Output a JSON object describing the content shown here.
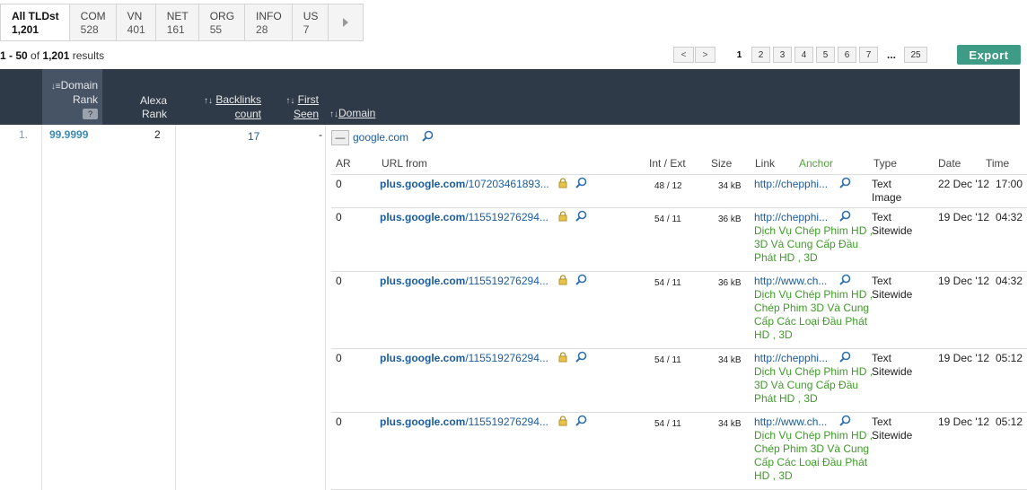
{
  "tld_tabs": [
    {
      "label": "All TLDst",
      "count": "1,201",
      "active": true
    },
    {
      "label": "COM",
      "count": "528"
    },
    {
      "label": "VN",
      "count": "401"
    },
    {
      "label": "NET",
      "count": "161"
    },
    {
      "label": "ORG",
      "count": "55"
    },
    {
      "label": "INFO",
      "count": "28"
    },
    {
      "label": "US",
      "count": "7"
    }
  ],
  "tld_next_icon": "triangle-right-icon",
  "results": {
    "range": "1 - 50",
    "of": "of",
    "total": "1,201",
    "suffix": "results"
  },
  "pager": {
    "prev": "<",
    "next": ">",
    "pages": [
      "1",
      "2",
      "3",
      "4",
      "5",
      "6",
      "7"
    ],
    "ellipsis": "...",
    "last": "25",
    "current": "1"
  },
  "export_label": "Export",
  "columns": {
    "domain_rank": "Domain Rank",
    "domain_rank_help": "?",
    "alexa_rank": "Alexa Rank",
    "backlinks": "Backlinks count",
    "first_seen": "First Seen",
    "domain": "Domain"
  },
  "row": {
    "index": "1.",
    "domain_rank": "99.9999",
    "alexa_rank": "2",
    "backlinks": "17",
    "first_seen": "-",
    "toggle": "—",
    "domain": "google.com"
  },
  "inner_headers": {
    "ar": "AR",
    "url_from": "URL from",
    "int_ext": "Int / Ext",
    "size": "Size",
    "link": "Link",
    "anchor": "Anchor",
    "type": "Type",
    "date": "Date",
    "time": "Time"
  },
  "backlinks": [
    {
      "ar": "0",
      "url_host": "plus.google.com",
      "url_path": "/107203461893...",
      "int_ext": "48 / 12",
      "size": "34 kB",
      "link": "http://chepphi...",
      "anchor": "",
      "type": "Text Image",
      "date": "22 Dec '12",
      "time": "17:00"
    },
    {
      "ar": "0",
      "url_host": "plus.google.com",
      "url_path": "/115519276294...",
      "int_ext": "54 / 11",
      "size": "36 kB",
      "link": "http://chepphi...",
      "anchor": "Dịch Vụ Chép Phim HD , 3D Và Cung Cấp Đầu Phát HD , 3D",
      "type": "Text Sitewide",
      "date": "19 Dec '12",
      "time": "04:32"
    },
    {
      "ar": "0",
      "url_host": "plus.google.com",
      "url_path": "/115519276294...",
      "int_ext": "54 / 11",
      "size": "36 kB",
      "link": "http://www.ch...",
      "anchor": "Dịch Vụ Chép Phim HD , Chép Phim 3D Và Cung Cấp Các Loại Đầu Phát HD , 3D",
      "type": "Text Sitewide",
      "date": "19 Dec '12",
      "time": "04:32"
    },
    {
      "ar": "0",
      "url_host": "plus.google.com",
      "url_path": "/115519276294...",
      "int_ext": "54 / 11",
      "size": "34 kB",
      "link": "http://chepphi...",
      "anchor": "Dịch Vụ Chép Phim HD , 3D Và Cung Cấp Đầu Phát HD , 3D",
      "type": "Text Sitewide",
      "date": "19 Dec '12",
      "time": "05:12"
    },
    {
      "ar": "0",
      "url_host": "plus.google.com",
      "url_path": "/115519276294...",
      "int_ext": "54 / 11",
      "size": "34 kB",
      "link": "http://www.ch...",
      "anchor": "Dịch Vụ Chép Phim HD , Chép Phim 3D Và Cung Cấp Các Loại Đầu Phát HD , 3D",
      "type": "Text Sitewide",
      "date": "19 Dec '12",
      "time": "05:12"
    }
  ],
  "icons": {
    "lock": "lock-icon",
    "magnifier": "magnifier-icon"
  },
  "colors": {
    "header_bg": "#2f3a48",
    "export_bg": "#3d9b86",
    "anchor_text": "#3f9a2a",
    "link_text": "#1a5c9c"
  }
}
